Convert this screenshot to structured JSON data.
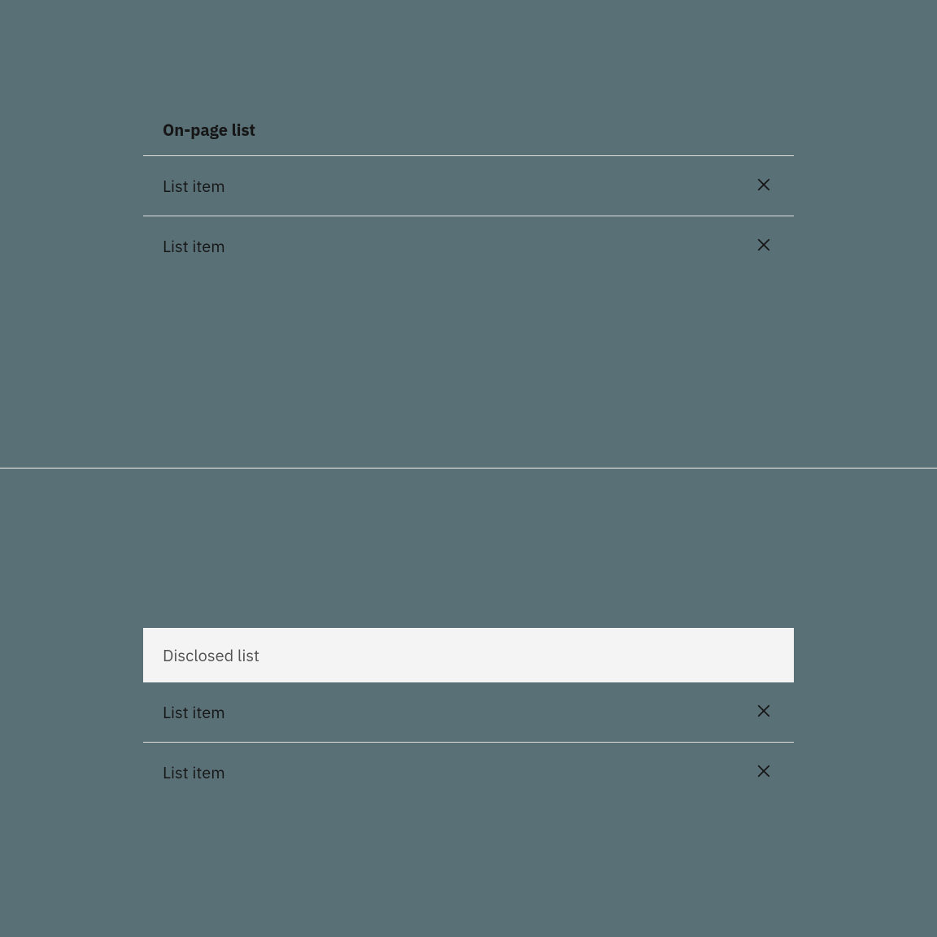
{
  "onPageList": {
    "heading": "On-page list",
    "items": [
      {
        "label": "List item"
      },
      {
        "label": "List item"
      }
    ]
  },
  "disclosedList": {
    "heading": "Disclosed list",
    "items": [
      {
        "label": "List item"
      },
      {
        "label": "List item"
      }
    ]
  }
}
